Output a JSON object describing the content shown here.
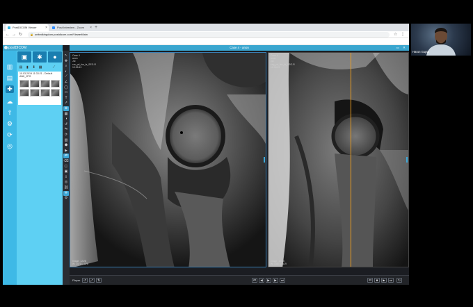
{
  "browser": {
    "tabs": [
      {
        "label": "PostDICOM Viewer",
        "active": true,
        "color": "#3eb9e6"
      },
      {
        "label": "Post Interview - Zoom",
        "active": false,
        "color": "#2d8cff"
      }
    ],
    "url": "unitedkingdom.postdicom.com/ViewerMain",
    "bookmarks": [
      {
        "label": "Apps",
        "color": "#4285f4"
      },
      {
        "label": "Adobe eBooks",
        "color": "#d93025"
      },
      {
        "label": "X-Ray Oxygen",
        "color": "#f9ab00"
      },
      {
        "label": "Banner profile",
        "color": "#1e8e3e"
      },
      {
        "label": "X-Ray Oxygen",
        "color": "#f9ab00"
      },
      {
        "label": "X-Ray Oxygen",
        "color": "#f9ab00"
      },
      {
        "label": "Google",
        "color": "#4285f4"
      },
      {
        "label": "Streamyrdle Fine...",
        "color": "#9334e6"
      },
      {
        "label": "My IS",
        "color": "#d93025"
      },
      {
        "label": "YEAZ Lock - Goo...",
        "color": "#1e8e3e"
      },
      {
        "label": "Zoom",
        "color": "#2d8cff"
      },
      {
        "label": "Lucy",
        "color": "#f9ab00"
      },
      {
        "label": "Verywealth Lands...",
        "color": "#1e8e3e"
      },
      {
        "label": "Anatomy Notes - Vis...",
        "color": "#4285f4"
      },
      {
        "label": "Stack Recommen...",
        "color": "#9334e6"
      },
      {
        "label": "Learn Triple Anat...",
        "color": "#d93025"
      },
      {
        "label": "Top 10 Technical S...",
        "color": "#f9ab00"
      },
      {
        "label": "Seesaw",
        "color": "#1e8e3e"
      },
      {
        "label": "iPhone Photograp...",
        "color": "#4285f4"
      }
    ]
  },
  "app": {
    "brand": "postDICOM",
    "case_title": "Case 4 - anon",
    "study": {
      "title": "10.03.2019 11:33:21 - Default",
      "subtitle": "ANK_JPG"
    },
    "left_viewport": {
      "meta": [
        "Case 4",
        "anon",
        "Jul",
        "cor_pd_fse_fs_SEG-R",
        "10:35:43"
      ],
      "footer": [
        "Image: 12/28",
        "W: 1471 L: 878"
      ]
    },
    "right_viewport": {
      "meta": [
        "Case 4",
        "anon",
        "Jul",
        "sag_pd_fse_fs_SEG-R",
        "10:35:45"
      ],
      "footer": [
        "Image: 15/15",
        "W: 1387 L: 619"
      ]
    },
    "status_label": "Player"
  },
  "webcam": {
    "name": "Harun Gupta"
  },
  "colors": {
    "sidebar": "#3eb9e6",
    "panel": "#5ed0f3",
    "header": "#3aa6cf",
    "crosshair": "#f0a020"
  }
}
